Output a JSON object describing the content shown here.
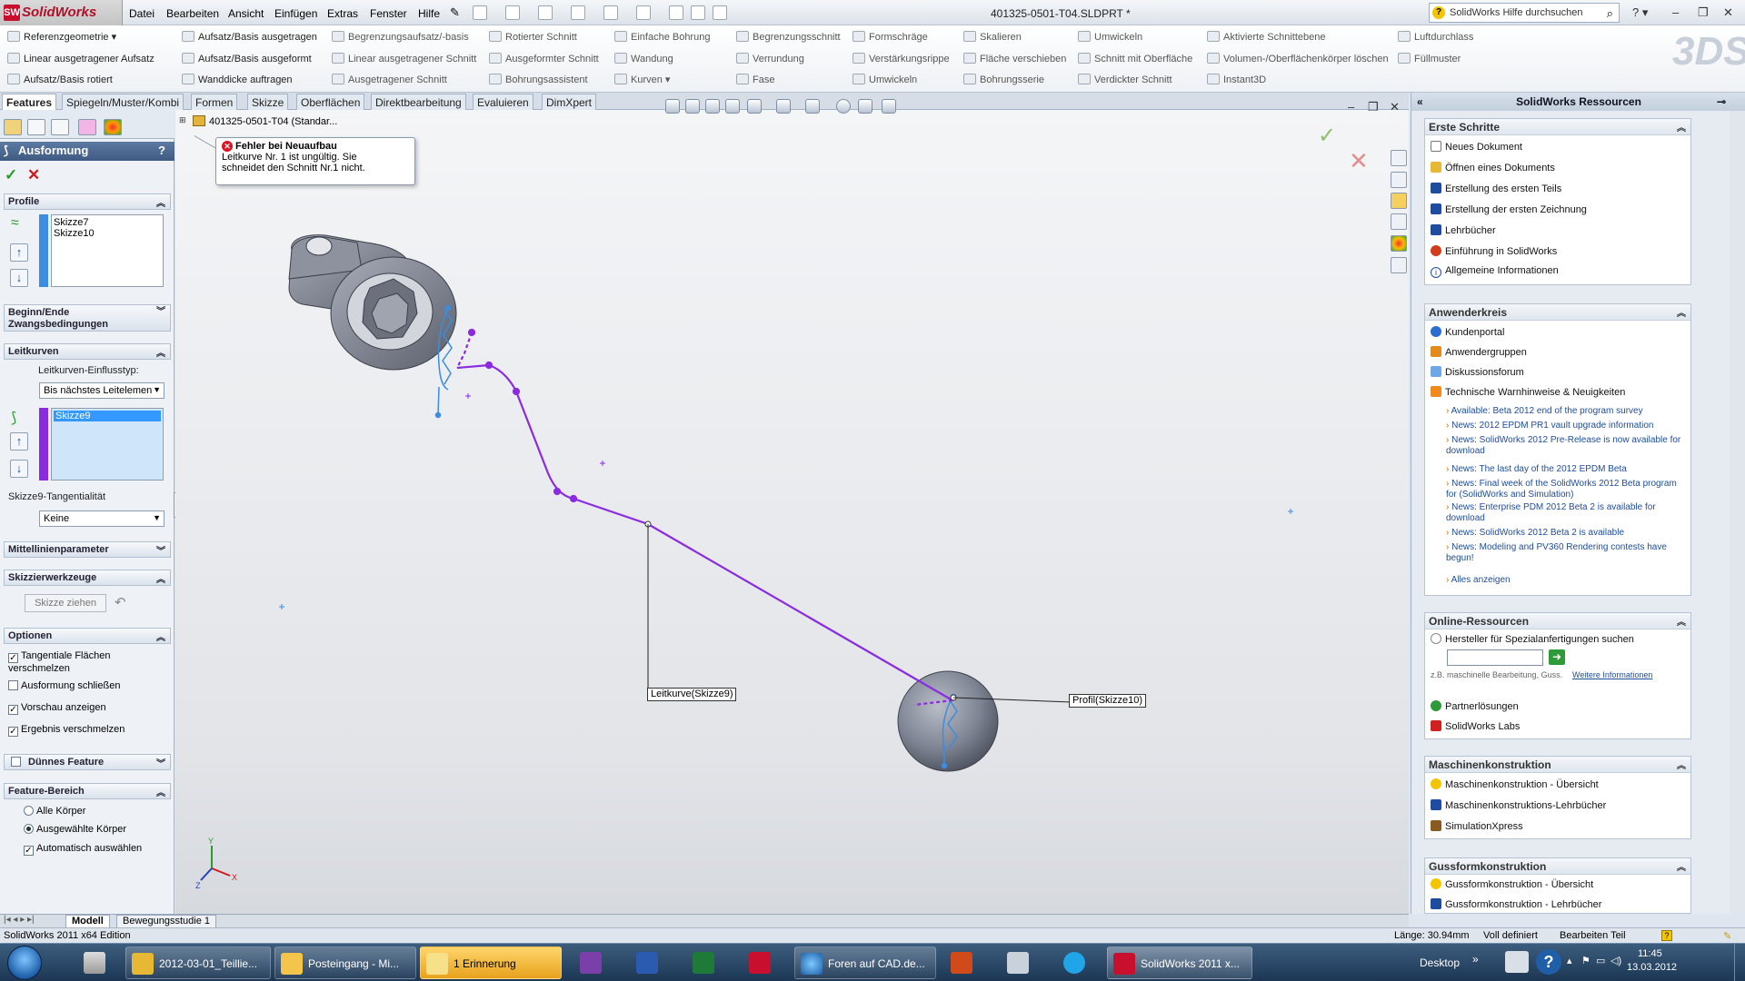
{
  "titlebar": {
    "app_name": "SolidWorks",
    "menu": [
      "Datei",
      "Bearbeiten",
      "Ansicht",
      "Einfügen",
      "Extras",
      "Fenster",
      "Hilfe"
    ],
    "document_title": "401325-0501-T04.SLDPRT *",
    "help_search_placeholder": "SolidWorks Hilfe durchsuchen"
  },
  "ribbon": {
    "col1": [
      "Referenzgeometrie",
      "Linear ausgetragener Aufsatz",
      "Aufsatz/Basis rotiert"
    ],
    "col2": [
      "Aufsatz/Basis ausgetragen",
      "Aufsatz/Basis ausgeformt",
      "Wanddicke auftragen"
    ],
    "col3": [
      "Begrenzungsaufsatz/-basis",
      "Linear ausgetragener Schnitt",
      "Ausgetragener Schnitt"
    ],
    "col4": [
      "Rotierter Schnitt",
      "Ausgeformter Schnitt",
      "Bohrungsassistent"
    ],
    "col5": [
      "Einfache Bohrung",
      "Wandung",
      "Kurven"
    ],
    "col6": [
      "Begrenzungsschnitt",
      "Verrundung",
      "Fase"
    ],
    "col7": [
      "Formschräge",
      "Verstärkungsrippe",
      "Umwickeln"
    ],
    "col8": [
      "Skalieren",
      "Fläche verschieben",
      "Bohrungsserie"
    ],
    "col9": [
      "Umwickeln",
      "Schnitt mit Oberfläche",
      "Verdickter Schnitt"
    ],
    "col10": [
      "Aktivierte Schnittebene",
      "Volumen-/Oberflächenkörper löschen",
      "Instant3D"
    ],
    "col11": [
      "Luftdurchlass",
      "Füllmuster"
    ]
  },
  "tabs": [
    "Features",
    "Spiegeln/Muster/Kombi",
    "Formen",
    "Skizze",
    "Oberflächen",
    "Direktbearbeitung",
    "Evaluieren",
    "DimXpert"
  ],
  "property_manager": {
    "title": "Ausformung",
    "help": "?",
    "profile": {
      "label": "Profile",
      "items": [
        "Skizze7",
        "Skizze10"
      ]
    },
    "start_end": {
      "label": "Beginn/Ende Zwangsbedingungen"
    },
    "guides": {
      "label": "Leitkurven",
      "influence_label": "Leitkurven-Einflusstyp:",
      "influence_value": "Bis nächstes Leitelemen",
      "items": [
        "Skizze9"
      ],
      "tangency_label": "Skizze9-Tangentialität",
      "tangency_value": "Keine"
    },
    "centerline": {
      "label": "Mittellinienparameter"
    },
    "sketch_tools": {
      "label": "Skizzierwerkzeuge",
      "drag_button": "Skizze ziehen"
    },
    "options": {
      "label": "Optionen",
      "merge_tangent": "Tangentiale Flächen verschmelzen",
      "close_loft": "Ausformung schließen",
      "show_preview": "Vorschau anzeigen",
      "merge_result": "Ergebnis verschmelzen"
    },
    "thin_feature": {
      "label": "Dünnes Feature"
    },
    "feature_scope": {
      "label": "Feature-Bereich",
      "all_bodies": "Alle Körper",
      "selected_bodies": "Ausgewählte Körper",
      "auto_select": "Automatisch auswählen"
    }
  },
  "viewport": {
    "tree_item": "401325-0501-T04 (Standar...",
    "error_title": "Fehler bei Neuaufbau",
    "error_text_1": "Leitkurve Nr. 1 ist ungültig. Sie",
    "error_text_2": "schneidet den Schnitt Nr.1  nicht.",
    "callout_guide": "Leitkurve(Skizze9)",
    "callout_profile": "Profil(Skizze10)",
    "triad_x": "X",
    "triad_y": "Y",
    "triad_z": "Z",
    "colors": {
      "guide_curve": "#8a2be2",
      "profile_sketch": "#3a8de0",
      "body": "#7b8190"
    }
  },
  "resources": {
    "title": "SolidWorks Ressourcen",
    "first_steps": {
      "label": "Erste Schritte",
      "items": [
        "Neues Dokument",
        "Öffnen eines Dokuments",
        "Erstellung des ersten Teils",
        "Erstellung der ersten Zeichnung",
        "Lehrbücher",
        "Einführung in SolidWorks",
        "Allgemeine Informationen"
      ]
    },
    "community": {
      "label": "Anwenderkreis",
      "items": [
        "Kundenportal",
        "Anwendergruppen",
        "Diskussionsforum",
        "Technische Warnhinweise & Neuigkeiten"
      ],
      "news": [
        "Available: Beta 2012 end of the program survey",
        "News: 2012 EPDM PR1 vault upgrade information",
        "News: SolidWorks 2012 Pre-Release is now available for download",
        "News: The last day of the 2012 EPDM Beta",
        "News: Final week of the SolidWorks 2012 Beta program for (SolidWorks and Simulation)",
        "News: Enterprise PDM 2012 Beta 2 is available for download",
        "News: SolidWorks 2012 Beta 2 is available",
        "News: Modeling and PV360 Rendering contests have begun!"
      ],
      "show_all": "Alles anzeigen"
    },
    "online": {
      "label": "Online-Ressourcen",
      "search_label": "Hersteller für Spezialanfertigungen suchen",
      "example": "z.B. maschinelle Bearbeitung, Guss.",
      "more": "Weitere Informationen",
      "items": [
        "Partnerlösungen",
        "SolidWorks Labs"
      ]
    },
    "machine": {
      "label": "Maschinenkonstruktion",
      "items": [
        "Maschinenkonstruktion - Übersicht",
        "Maschinenkonstruktions-Lehrbücher",
        "SimulationXpress"
      ]
    },
    "casting": {
      "label": "Gussformkonstruktion",
      "items": [
        "Gussformkonstruktion - Übersicht",
        "Gussformkonstruktion - Lehrbücher"
      ]
    }
  },
  "bottom_tabs": [
    "Modell",
    "Bewegungsstudie 1"
  ],
  "status": {
    "edition": "SolidWorks 2011 x64 Edition",
    "length": "Länge: 30.94mm",
    "defined": "Voll definiert",
    "mode": "Bearbeiten Teil"
  },
  "taskbar": {
    "items": [
      "2012-03-01_Teillie...",
      "Posteingang - Mi...",
      "1 Erinnerung",
      "Foren auf CAD.de...",
      "SolidWorks 2011 x..."
    ],
    "desktop": "Desktop",
    "time": "11:45",
    "date": "13.03.2012"
  }
}
